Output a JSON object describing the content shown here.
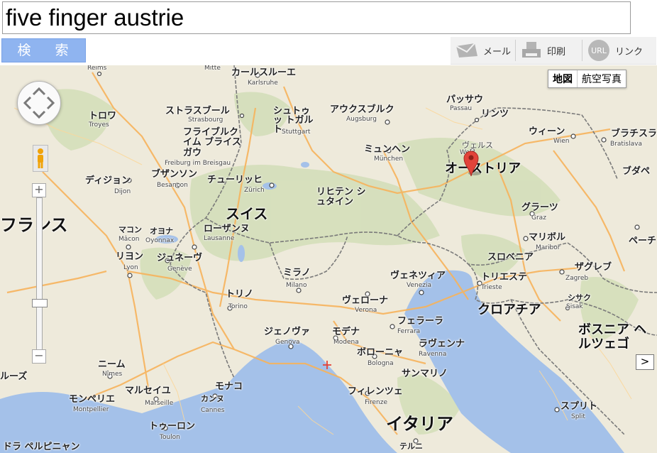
{
  "search": {
    "value": "five finger austrie",
    "button_label": "検 索"
  },
  "toolbar": {
    "mail": "メール",
    "print": "印刷",
    "link": "リンク",
    "url_badge": "URL"
  },
  "maptype": {
    "map": "地図",
    "satellite": "航空写真"
  },
  "zoom": {
    "plus": "+",
    "minus": "−"
  },
  "expand": ">",
  "labels": {
    "reims": "Reims",
    "mitte": "Mitte",
    "karlsruhe_jp": "カールスルーエ",
    "karlsruhe_en": "Karlsruhe",
    "strasbourg_jp": "ストラスブール",
    "strasbourg_en": "Strasbourg",
    "troyes_jp": "トロワ",
    "troyes_en": "Troyes",
    "stuttgart_jp": "シュトゥッ トガルト",
    "stuttgart_en": "Stuttgart",
    "augsburg_jp": "アウクスブルク",
    "augsburg_en": "Augsburg",
    "passau_jp": "パッサウ",
    "passau_en": "Passau",
    "linz_jp": "リンツ",
    "vienna_jp": "ウィーン",
    "vienna_en": "Wien",
    "bratislava_jp": "ブラチスラ",
    "bratislava_en": "Bratislava",
    "freiburg_jp": "フライブルク イム ブライスガウ",
    "freiburg_en": "Freiburg im Breisgau",
    "munich_jp": "ミュンヘン",
    "munich_en": "München",
    "wels_jp": "ヴェルス",
    "wels_en": "Wels",
    "austria": "オーストリア",
    "budapest_jp": "ブダペ",
    "dijon_jp": "ディジョン",
    "dijon_en": "Dijon",
    "besancon_jp": "ブザンソン",
    "besancon_en": "Besançon",
    "zurich_jp": "チューリッヒ",
    "zurich_en": "Zürich",
    "liechtenstein": "リヒテン シュタイン",
    "graz_jp": "グラーツ",
    "graz_en": "Graz",
    "switzerland": "スイス",
    "france": "フランス",
    "macon_jp": "マコン",
    "macon_en": "Mâcon",
    "oyonnax_jp": "オヨナ",
    "oyonnax_en": "Oyonnax",
    "lausanne_jp": "ローザンヌ",
    "lausanne_en": "Lausanne",
    "maribor_jp": "マリボル",
    "maribor_en": "Maribor",
    "pecs": "ペーチ",
    "lyon_jp": "リヨン",
    "lyon_en": "Lyon",
    "geneve_jp": "ジュネーヴ",
    "geneve_en": "Genève",
    "slovenia": "スロベニア",
    "zagreb_jp": "ザグレブ",
    "zagreb_en": "Zagreb",
    "milan_jp": "ミラノ",
    "milan_en": "Milano",
    "venice_jp": "ヴェネツィア",
    "venice_en": "Venezia",
    "trieste_jp": "トリエステ",
    "trieste_en": "Trieste",
    "sisak_jp": "シサク",
    "sisak_en": "Sisak",
    "turin_jp": "トリノ",
    "turin_en": "Torino",
    "verona_jp": "ヴェローナ",
    "verona_en": "Verona",
    "croatia": "クロアチア",
    "ferrara_jp": "フェラーラ",
    "ferrara_en": "Ferrara",
    "genoa_jp": "ジェノヴァ",
    "genoa_en": "Genova",
    "modena_jp": "モデナ",
    "modena_en": "Modena",
    "ravenna_jp": "ラヴェンナ",
    "ravenna_en": "Ravenna",
    "bosnia": "ボスニア ヘルツェゴ",
    "bologna_jp": "ボローニャ",
    "bologna_en": "Bologna",
    "nimes_jp": "ニーム",
    "nimes_en": "Nîmes",
    "ruse": "ルーズ",
    "san_marino": "サンマリノ",
    "monaco": "モナコ",
    "marseille_jp": "マルセイユ",
    "marseille_en": "Marseille",
    "montpellier_jp": "モンペリエ",
    "montpellier_en": "Montpellier",
    "cannes_jp": "カンヌ",
    "cannes_en": "Cannes",
    "florence_jp": "フィレンツェ",
    "florence_en": "Firenze",
    "split_jp": "スプリト",
    "split_en": "Split",
    "italy": "イタリア",
    "toulon_jp": "トゥーロン",
    "toulon_en": "Toulon",
    "terni": "テルニ",
    "perpignan": "ドラ ペルピニャン"
  },
  "colors": {
    "land": "#eeeadb",
    "water": "#a4c1e9",
    "road": "#f7b35c",
    "border": "#6f6f6f",
    "marker": "#e2433a",
    "button": "#8fb4f0"
  }
}
